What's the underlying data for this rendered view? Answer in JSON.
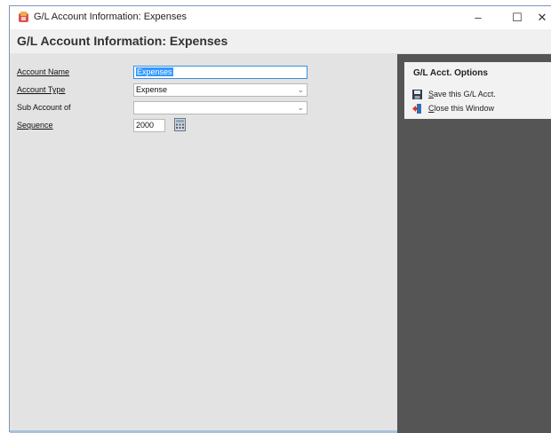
{
  "window": {
    "title": "G/L Account Information: Expenses",
    "controls": {
      "minimize": "–",
      "maximize": "☐",
      "close": "✕"
    }
  },
  "header": {
    "title": "G/L Account Information: Expenses"
  },
  "form": {
    "account_name": {
      "label": "Account Name",
      "value": "Expenses"
    },
    "account_type": {
      "label": "Account Type",
      "value": "Expense",
      "icon": "chevron-down-icon"
    },
    "sub_account_of": {
      "label": "Sub Account of",
      "value": "",
      "icon": "chevron-down-icon"
    },
    "sequence": {
      "label": "Sequence",
      "value": "2000",
      "icon": "calculator-icon"
    }
  },
  "options": {
    "title": "G/L Acct. Options",
    "items": [
      {
        "label": "Save this G/L Acct.",
        "icon": "floppy-disk-icon"
      },
      {
        "label": "Close this Window",
        "icon": "exit-door-icon"
      }
    ]
  },
  "colors": {
    "form_bg": "#e3e3e3",
    "side_bg": "#555555",
    "selection": "#3399ff",
    "focus_border": "#3c8be0"
  }
}
